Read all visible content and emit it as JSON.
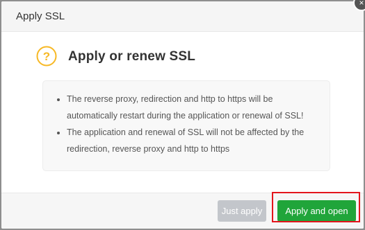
{
  "dialog": {
    "title": "Apply SSL",
    "close_glyph": "×"
  },
  "confirm": {
    "icon": "question-circle-icon",
    "icon_glyph": "?",
    "icon_color": "#f7b824",
    "title": "Apply or renew SSL"
  },
  "info": {
    "items": [
      "The reverse proxy, redirection and http to https will be automatically restart during the application or renewal of SSL!",
      "The application and renewal of SSL will not be affected by the redirection, reverse proxy and http to https"
    ]
  },
  "footer": {
    "just_apply_label": "Just apply",
    "apply_open_label": "Apply and open"
  },
  "colors": {
    "primary_green": "#20a53a",
    "disabled_gray": "#c3c6cb",
    "highlight_red": "#e3141c"
  }
}
